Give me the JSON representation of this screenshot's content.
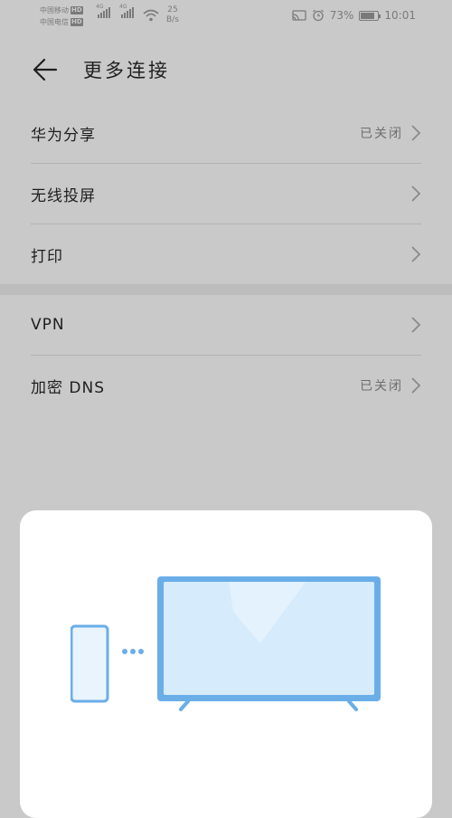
{
  "status_bar": {
    "carrier1": "中国移动",
    "carrier2": "中国电信",
    "hd": "HD",
    "net1": "4G",
    "net2": "4G",
    "speed_value": "25",
    "speed_unit": "B/s",
    "battery_pct": "73%",
    "battery_level": 0.73,
    "time": "10:01"
  },
  "header": {
    "title": "更多连接"
  },
  "settings": {
    "group1": [
      {
        "label": "华为分享",
        "value": "已关闭"
      },
      {
        "label": "无线投屏",
        "value": ""
      },
      {
        "label": "打印",
        "value": ""
      }
    ],
    "group2": [
      {
        "label": "VPN",
        "value": ""
      },
      {
        "label": "加密 DNS",
        "value": "已关闭"
      }
    ]
  },
  "icons": {
    "back": "arrow-left-icon",
    "chevron": "chevron-right-icon",
    "cast": "screen-cast-icon",
    "alarm": "alarm-clock-icon",
    "wifi": "wifi-icon"
  },
  "colors": {
    "background": "#c9c9c9",
    "card": "#ffffff",
    "illustration_blue": "#6aaee8",
    "screen_fill": "#d6ebfb"
  }
}
